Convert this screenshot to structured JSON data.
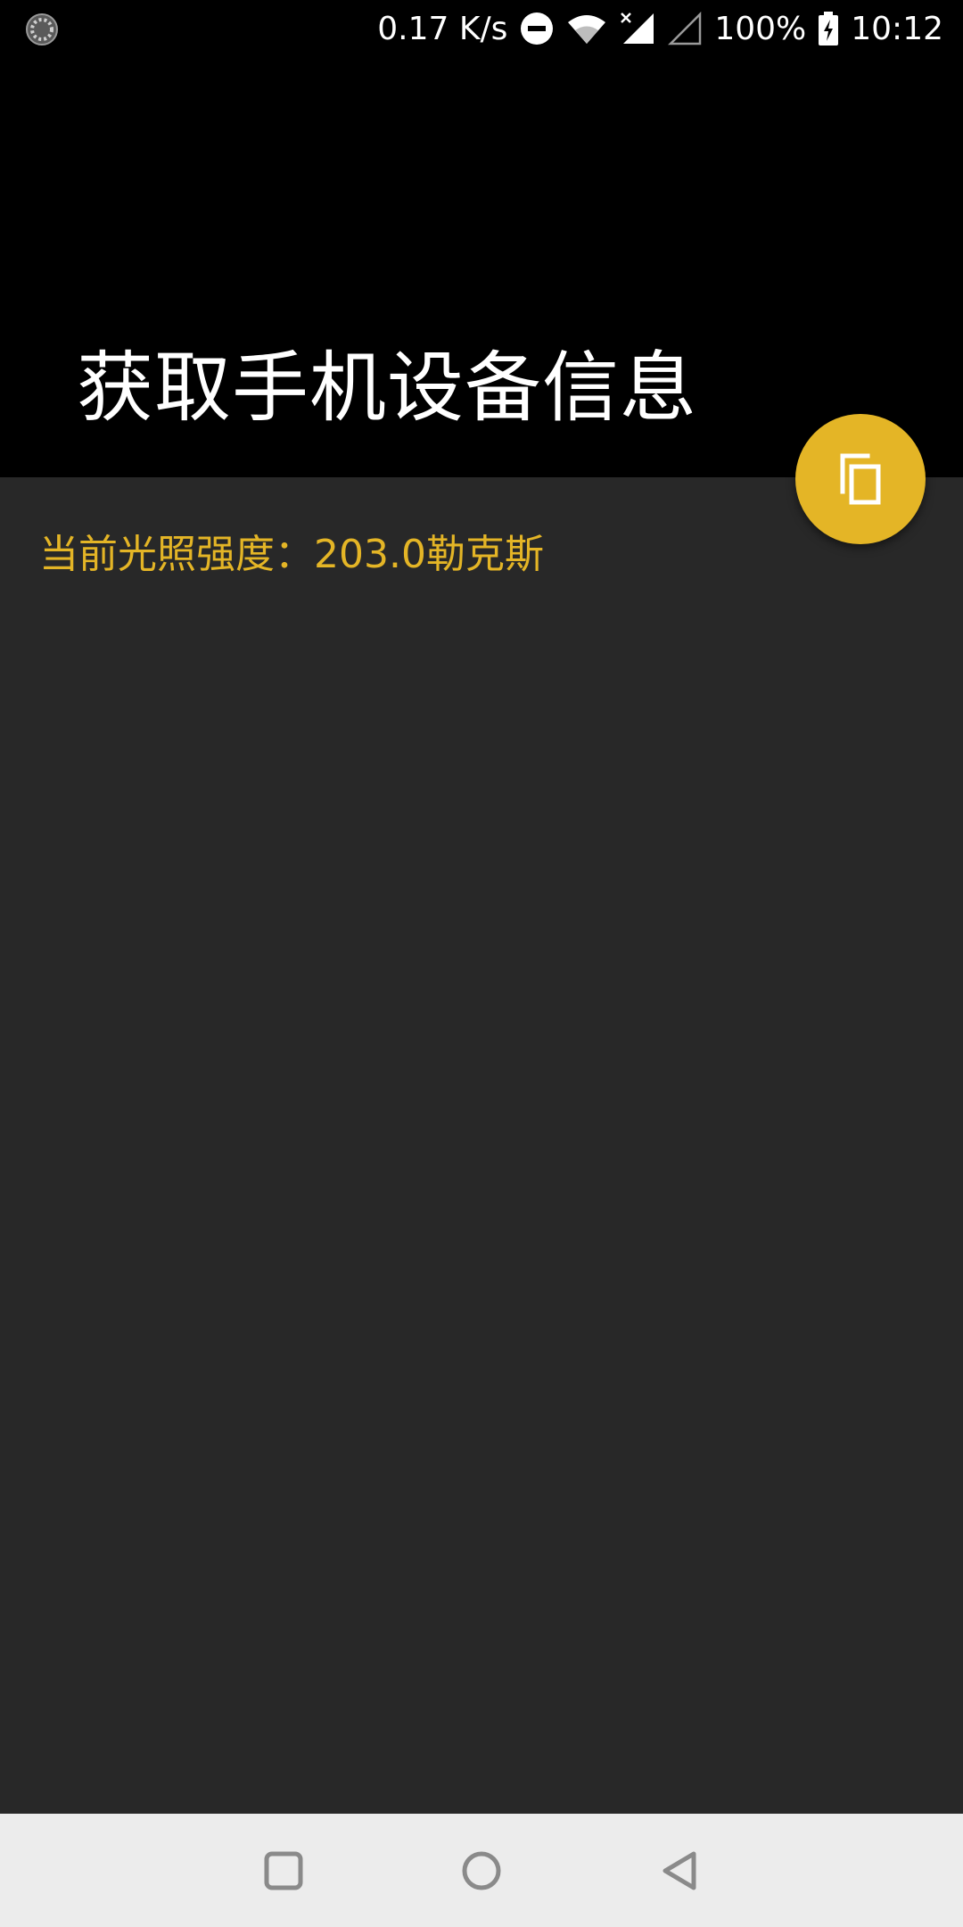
{
  "status_bar": {
    "network_speed": "0.17 K/s",
    "battery": "100%",
    "time": "10:12"
  },
  "app_bar": {
    "title": "获取手机设备信息"
  },
  "content": {
    "light_text": "当前光照强度：203.0勒克斯"
  },
  "icons": {
    "status_left": "loading-circle-icon",
    "dnd": "do-not-disturb-icon",
    "wifi": "wifi-icon",
    "signal_1": "signal-no-data-icon",
    "signal_2": "signal-empty-icon",
    "battery": "battery-charging-icon",
    "fab": "copy-icon",
    "nav_recents": "recents-square-icon",
    "nav_home": "home-circle-icon",
    "nav_back": "back-triangle-icon"
  },
  "colors": {
    "accent": "#e4b526",
    "app_bar_bg": "#000000",
    "content_bg": "#282828",
    "nav_bar_bg": "#ececec"
  }
}
